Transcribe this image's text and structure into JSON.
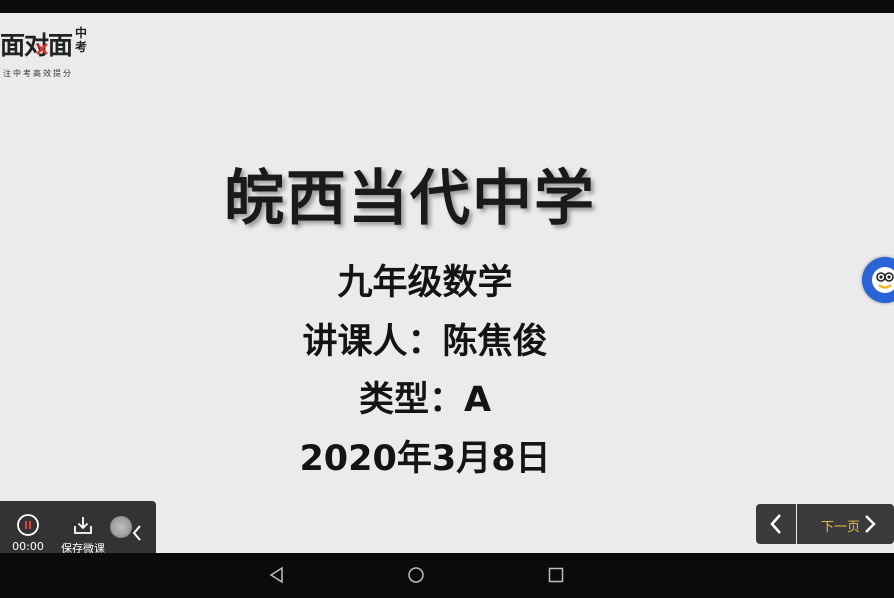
{
  "logo": {
    "main_text": "面对面",
    "side_text": "中考",
    "slogan": "注中考高效提分"
  },
  "slide": {
    "title": "皖西当代中学",
    "subject": "九年级数学",
    "lecturer": "讲课人：陈焦俊",
    "type": "类型：A",
    "date": "2020年3月8日"
  },
  "control_panel": {
    "timer": "00:00",
    "save_label": "保存微课"
  },
  "page_nav": {
    "next_label": "下一页"
  },
  "icons": [
    "pause-icon",
    "download-icon",
    "chevron-left-icon",
    "chevron-right-icon",
    "assistant-icon",
    "back-icon",
    "home-icon",
    "recents-icon"
  ],
  "colors": {
    "slide_bg": "#ebebeb",
    "next_label": "#e8b84a",
    "pause_accent": "#e0453a",
    "assistant": "#2a63d6"
  }
}
